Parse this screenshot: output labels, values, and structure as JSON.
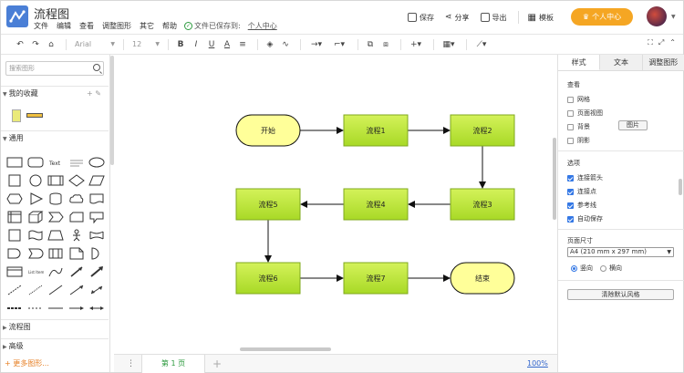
{
  "app": {
    "title": "流程图"
  },
  "menu": [
    "文件",
    "编辑",
    "查看",
    "调整图形",
    "其它",
    "帮助"
  ],
  "save_status": {
    "text": "文件已保存到:",
    "target": "个人中心"
  },
  "header_actions": {
    "save": "保存",
    "share": "分享",
    "export": "导出",
    "template": "模板"
  },
  "user_center": "个人中心",
  "toolbar": {
    "font": "Arial",
    "font_size": "12"
  },
  "left_panel": {
    "search_placeholder": "搜索图形",
    "favorites": "我的收藏",
    "general": "通用",
    "flowchart": "流程图",
    "advanced": "高级",
    "more_shapes": "更多图形..."
  },
  "diagram": {
    "nodes": [
      {
        "id": "start",
        "label": "开始",
        "kind": "terminal"
      },
      {
        "id": "p1",
        "label": "流程1",
        "kind": "process"
      },
      {
        "id": "p2",
        "label": "流程2",
        "kind": "process"
      },
      {
        "id": "p3",
        "label": "流程3",
        "kind": "process"
      },
      {
        "id": "p4",
        "label": "流程4",
        "kind": "process"
      },
      {
        "id": "p5",
        "label": "流程5",
        "kind": "process"
      },
      {
        "id": "p6",
        "label": "流程6",
        "kind": "process"
      },
      {
        "id": "p7",
        "label": "流程7",
        "kind": "process"
      },
      {
        "id": "end",
        "label": "结束",
        "kind": "terminal"
      }
    ],
    "edges": [
      [
        "start",
        "p1"
      ],
      [
        "p1",
        "p2"
      ],
      [
        "p2",
        "p3"
      ],
      [
        "p3",
        "p4"
      ],
      [
        "p4",
        "p5"
      ],
      [
        "p5",
        "p6"
      ],
      [
        "p6",
        "p7"
      ],
      [
        "p7",
        "end"
      ]
    ]
  },
  "bottom": {
    "page_tab": "第 1 页",
    "zoom": "100%"
  },
  "right_panel": {
    "tabs": [
      "样式",
      "文本",
      "调整图形"
    ],
    "view_title": "查看",
    "view_options": [
      {
        "label": "网格",
        "checked": false
      },
      {
        "label": "页面视图",
        "checked": false
      },
      {
        "label": "背景",
        "checked": false
      },
      {
        "label": "阴影",
        "checked": false
      }
    ],
    "image_button": "图片",
    "options_title": "选项",
    "options": [
      {
        "label": "连接箭头",
        "checked": true
      },
      {
        "label": "连接点",
        "checked": true
      },
      {
        "label": "参考线",
        "checked": true
      },
      {
        "label": "自动保存",
        "checked": true
      }
    ],
    "paper_title": "页面尺寸",
    "paper_size": "A4 (210 mm x 297 mm)",
    "orientation": [
      {
        "label": "竖向",
        "selected": true
      },
      {
        "label": "横向",
        "selected": false
      }
    ],
    "reset_button": "清除默认风格"
  },
  "colors": {
    "process_fill": "#b9e63a",
    "process_stroke": "#7fa81e",
    "terminal_fill": "#ffff99",
    "accent": "#f5a623"
  }
}
